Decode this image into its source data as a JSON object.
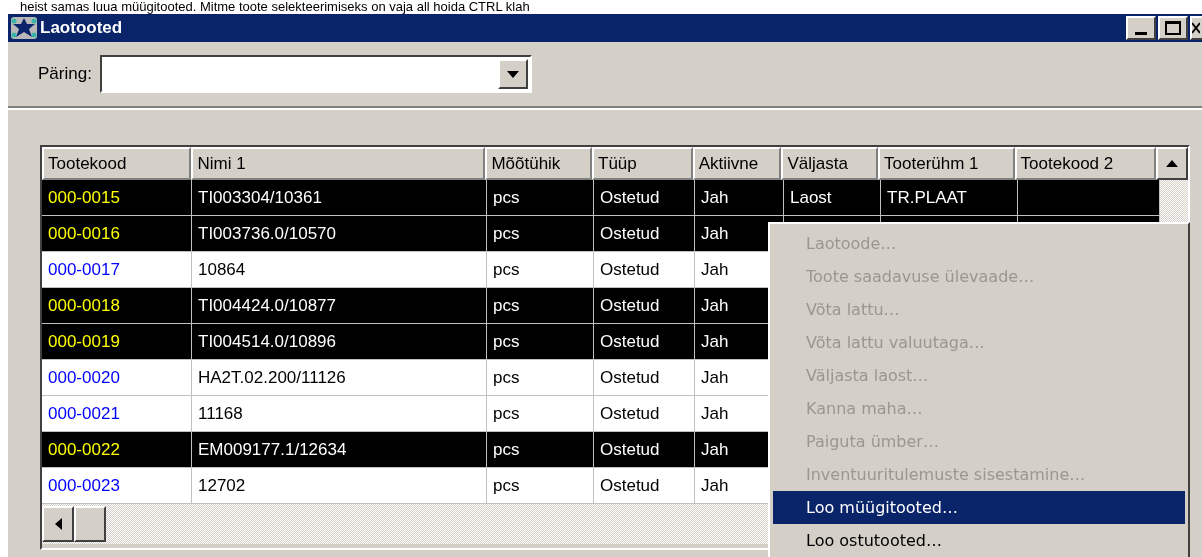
{
  "intro_text": "heist samas luua müügitooted. Mitme toote selekteerimiseks on vaja all hoida CTRL klah",
  "window": {
    "title": "Laotooted"
  },
  "query": {
    "label": "Päring:"
  },
  "table": {
    "columns": [
      "Tootekood",
      "Nimi 1",
      "Mõõtühik",
      "Tüüp",
      "Aktiivne",
      "Väljasta",
      "Tooterühm 1",
      "Tootekood 2"
    ],
    "rows": [
      {
        "selected": true,
        "cells": [
          "000-0015",
          "TI003304/10361",
          "pcs",
          "Ostetud",
          "Jah",
          "Laost",
          "TR.PLAAT"
        ]
      },
      {
        "selected": true,
        "cells": [
          "000-0016",
          "TI003736.0/10570",
          "pcs",
          "Ostetud",
          "Jah"
        ]
      },
      {
        "selected": false,
        "cells": [
          "000-0017",
          "10864",
          "pcs",
          "Ostetud",
          "Jah"
        ]
      },
      {
        "selected": true,
        "cells": [
          "000-0018",
          "TI004424.0/10877",
          "pcs",
          "Ostetud",
          "Jah"
        ]
      },
      {
        "selected": true,
        "cells": [
          "000-0019",
          "TI004514.0/10896",
          "pcs",
          "Ostetud",
          "Jah"
        ]
      },
      {
        "selected": false,
        "cells": [
          "000-0020",
          "HA2T.02.200/11126",
          "pcs",
          "Ostetud",
          "Jah"
        ]
      },
      {
        "selected": false,
        "cells": [
          "000-0021",
          "11168",
          "pcs",
          "Ostetud",
          "Jah"
        ]
      },
      {
        "selected": true,
        "cells": [
          "000-0022",
          "EM009177.1/12634",
          "pcs",
          "Ostetud",
          "Jah"
        ]
      },
      {
        "selected": false,
        "cells": [
          "000-0023",
          "12702",
          "pcs",
          "Ostetud",
          "Jah"
        ]
      }
    ]
  },
  "context_menu": {
    "items": [
      {
        "label": "Laotoode…",
        "disabled": true,
        "selected": false
      },
      {
        "label": "Toote saadavuse ülevaade…",
        "disabled": true,
        "selected": false
      },
      {
        "label": "Võta lattu…",
        "disabled": true,
        "selected": false
      },
      {
        "label": "Võta lattu valuutaga…",
        "disabled": true,
        "selected": false
      },
      {
        "label": "Väljasta laost…",
        "disabled": true,
        "selected": false
      },
      {
        "label": "Kanna maha…",
        "disabled": true,
        "selected": false
      },
      {
        "label": "Paiguta ümber…",
        "disabled": true,
        "selected": false
      },
      {
        "label": "Inventuuritulemuste sisestamine…",
        "disabled": true,
        "selected": false
      },
      {
        "label": "Loo müügitooted…",
        "disabled": false,
        "selected": true
      },
      {
        "label": "Loo ostutooted…",
        "disabled": false,
        "selected": false
      }
    ]
  }
}
